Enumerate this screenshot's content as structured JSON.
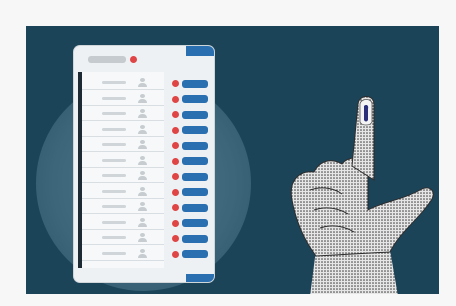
{
  "scene": {
    "subject": "",
    "colors": {
      "background": "#1c4459",
      "frame": "#f7f7f7",
      "machine_body": "#eef1f3",
      "button": "#2a6fb0",
      "indicator": "#e04545",
      "ink_mark": "#2b2f7a"
    },
    "ballot_rows": 12,
    "icons": [
      "person-icon",
      "vote-button",
      "indicator-light"
    ]
  }
}
